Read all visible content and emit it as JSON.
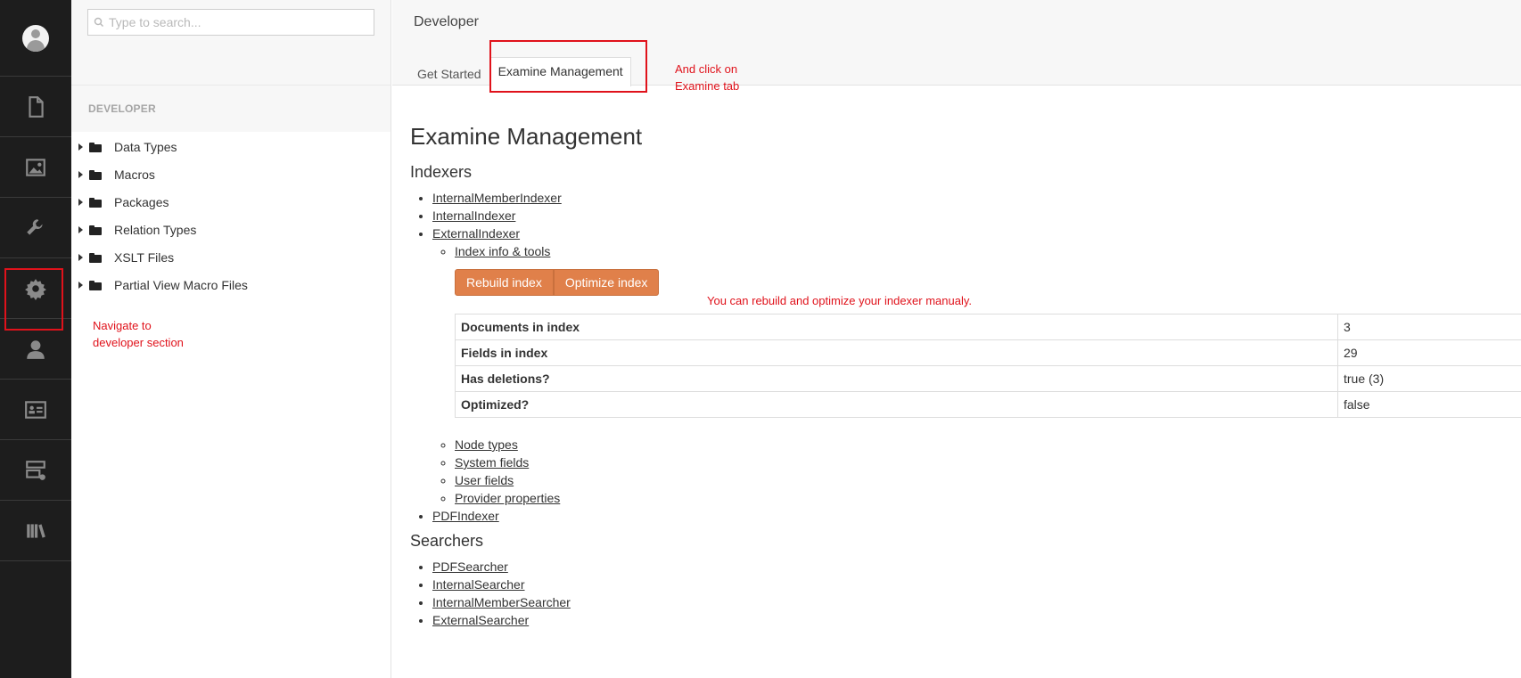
{
  "colors": {
    "annotation": "#e0121b",
    "button": "#e0804a",
    "rail": "#1d1d1d"
  },
  "rail": {
    "items": [
      {
        "icon": "document-icon"
      },
      {
        "icon": "image-icon"
      },
      {
        "icon": "wrench-icon"
      },
      {
        "icon": "gear-icon"
      },
      {
        "icon": "user-icon"
      },
      {
        "icon": "member-card-icon"
      },
      {
        "icon": "forms-icon"
      },
      {
        "icon": "library-icon"
      }
    ]
  },
  "tree": {
    "search_placeholder": "Type to search...",
    "header": "DEVELOPER",
    "items": [
      {
        "label": "Data Types"
      },
      {
        "label": "Macros"
      },
      {
        "label": "Packages"
      },
      {
        "label": "Relation Types"
      },
      {
        "label": "XSLT Files"
      },
      {
        "label": "Partial View Macro Files"
      }
    ]
  },
  "main": {
    "title": "Developer",
    "tabs": [
      {
        "label": "Get Started"
      },
      {
        "label": "Examine Management"
      }
    ],
    "page_heading": "Examine Management",
    "indexers_heading": "Indexers",
    "indexers": [
      "InternalMemberIndexer",
      "InternalIndexer",
      "ExternalIndexer"
    ],
    "index_info_link": "Index info & tools",
    "buttons": {
      "rebuild": "Rebuild index",
      "optimize": "Optimize index"
    },
    "info_table": [
      {
        "key": "Documents in index",
        "value": "3"
      },
      {
        "key": "Fields in index",
        "value": "29"
      },
      {
        "key": "Has deletions?",
        "value": "true (3)"
      },
      {
        "key": "Optimized?",
        "value": "false"
      }
    ],
    "sub_links": [
      "Node types",
      "System fields",
      "User fields",
      "Provider properties"
    ],
    "last_indexer": "PDFIndexer",
    "searchers_heading": "Searchers",
    "searchers": [
      "PDFSearcher",
      "InternalSearcher",
      "InternalMemberSearcher",
      "ExternalSearcher"
    ]
  },
  "annotations": {
    "navigate_line1": "Navigate to",
    "navigate_line2": "developer section",
    "click_line1": "And click on",
    "click_line2": "Examine tab",
    "rebuild_note": "You can rebuild and optimize your indexer manualy."
  }
}
